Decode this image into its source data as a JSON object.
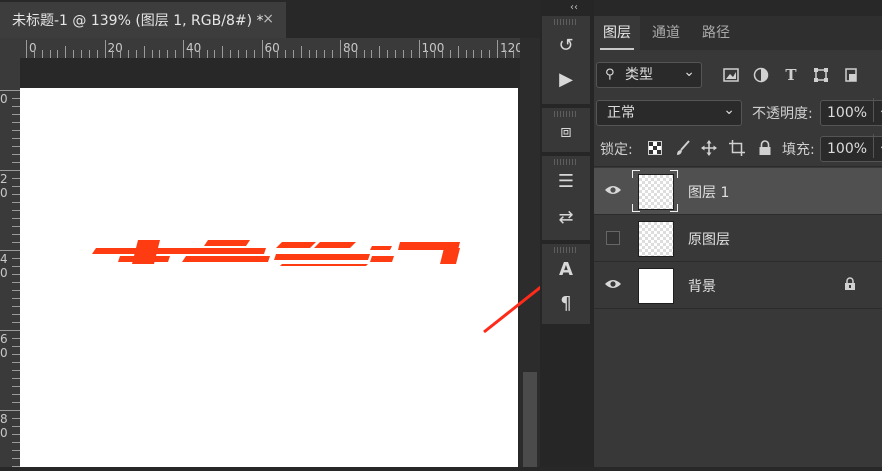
{
  "document": {
    "tab_title": "未标题-1 @ 139% (图层 1, RGB/8#) *",
    "close_glyph": "×"
  },
  "ruler": {
    "horizontal_labels": [
      "0",
      "20",
      "40",
      "60",
      "80",
      "100",
      "120"
    ],
    "vertical_labels": [
      "0",
      "2\n0",
      "4\n0",
      "6\n0",
      "8\n0"
    ]
  },
  "canvas": {
    "background": "#ffffff",
    "artwork_color": "#ff3b12",
    "annotation_arrow_color": "#ff2a1a"
  },
  "dock": {
    "collapse_glyph": "‹‹",
    "buttons": [
      {
        "name": "history-icon",
        "glyph": "↺"
      },
      {
        "name": "actions-icon",
        "glyph": "▶"
      },
      {
        "name": "3d-icon",
        "glyph": "⧈"
      },
      {
        "name": "brush-settings-icon",
        "glyph": "☰"
      },
      {
        "name": "adjustments-icon",
        "glyph": "⇄"
      },
      {
        "name": "character-icon",
        "glyph": "A"
      },
      {
        "name": "paragraph-icon",
        "glyph": "¶"
      }
    ]
  },
  "panel": {
    "tabs": [
      "图层",
      "通道",
      "路径"
    ],
    "active_tab": "图层",
    "filter": {
      "label": "类型",
      "chevron": "⌄"
    },
    "blend_mode": "正常",
    "opacity_label": "不透明度:",
    "opacity_value": "100%",
    "lock_label": "锁定:",
    "fill_label": "填充:",
    "fill_value": "100%",
    "layers": [
      {
        "name": "图层 1",
        "visible": true,
        "selected": true,
        "thumb": "transparent",
        "locked": false
      },
      {
        "name": "原图层",
        "visible": false,
        "selected": false,
        "thumb": "transparent",
        "locked": false
      },
      {
        "name": "背景",
        "visible": true,
        "selected": false,
        "thumb": "white",
        "locked": true
      }
    ]
  }
}
